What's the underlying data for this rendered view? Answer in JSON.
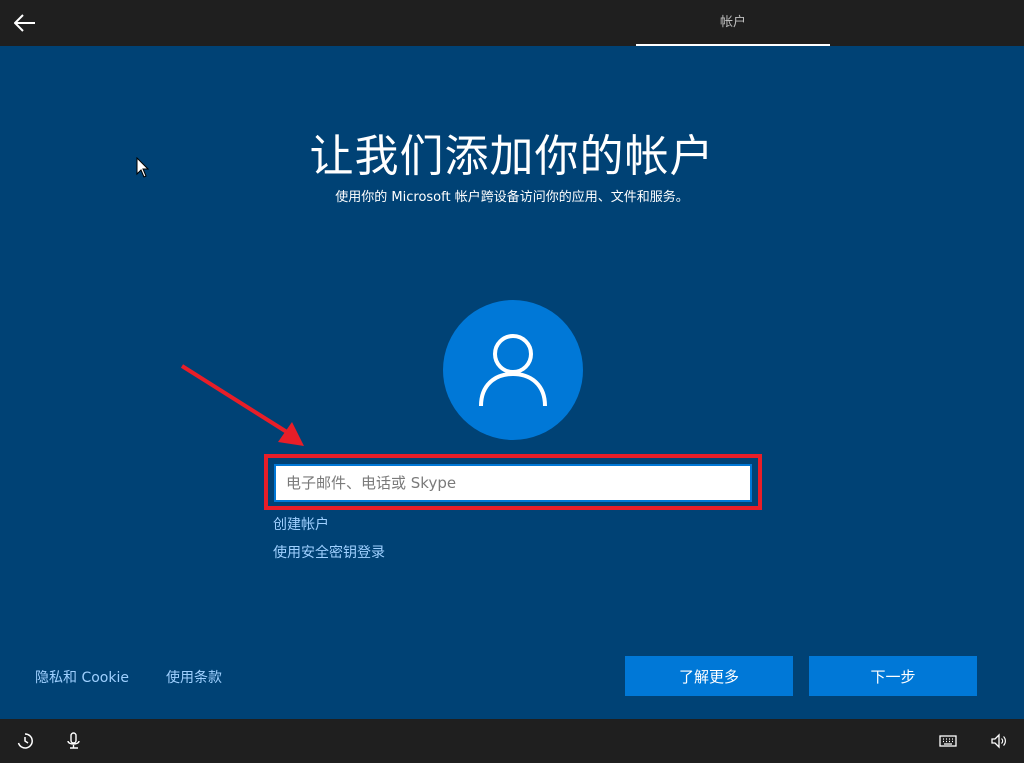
{
  "header": {
    "tab_label": "帐户"
  },
  "main": {
    "title": "让我们添加你的帐户",
    "subtitle": "使用你的 Microsoft 帐户跨设备访问你的应用、文件和服务。",
    "email_input": {
      "placeholder": "电子邮件、电话或 Skype",
      "value": ""
    },
    "links": {
      "create_account": "创建帐户",
      "security_key_signin": "使用安全密钥登录"
    }
  },
  "footer": {
    "privacy_link": "隐私和 Cookie",
    "terms_link": "使用条款",
    "learn_more_button": "了解更多",
    "next_button": "下一步"
  },
  "icons": {
    "back": "back-arrow-icon",
    "avatar": "user-icon",
    "ease_of_access": "ease-of-access-icon",
    "microphone": "microphone-icon",
    "keyboard": "keyboard-icon",
    "volume": "volume-icon"
  },
  "colors": {
    "background": "#004275",
    "accent": "#0078d7",
    "bar": "#1f1f1f",
    "highlight": "#e81e28",
    "link": "#9fd0ff"
  }
}
